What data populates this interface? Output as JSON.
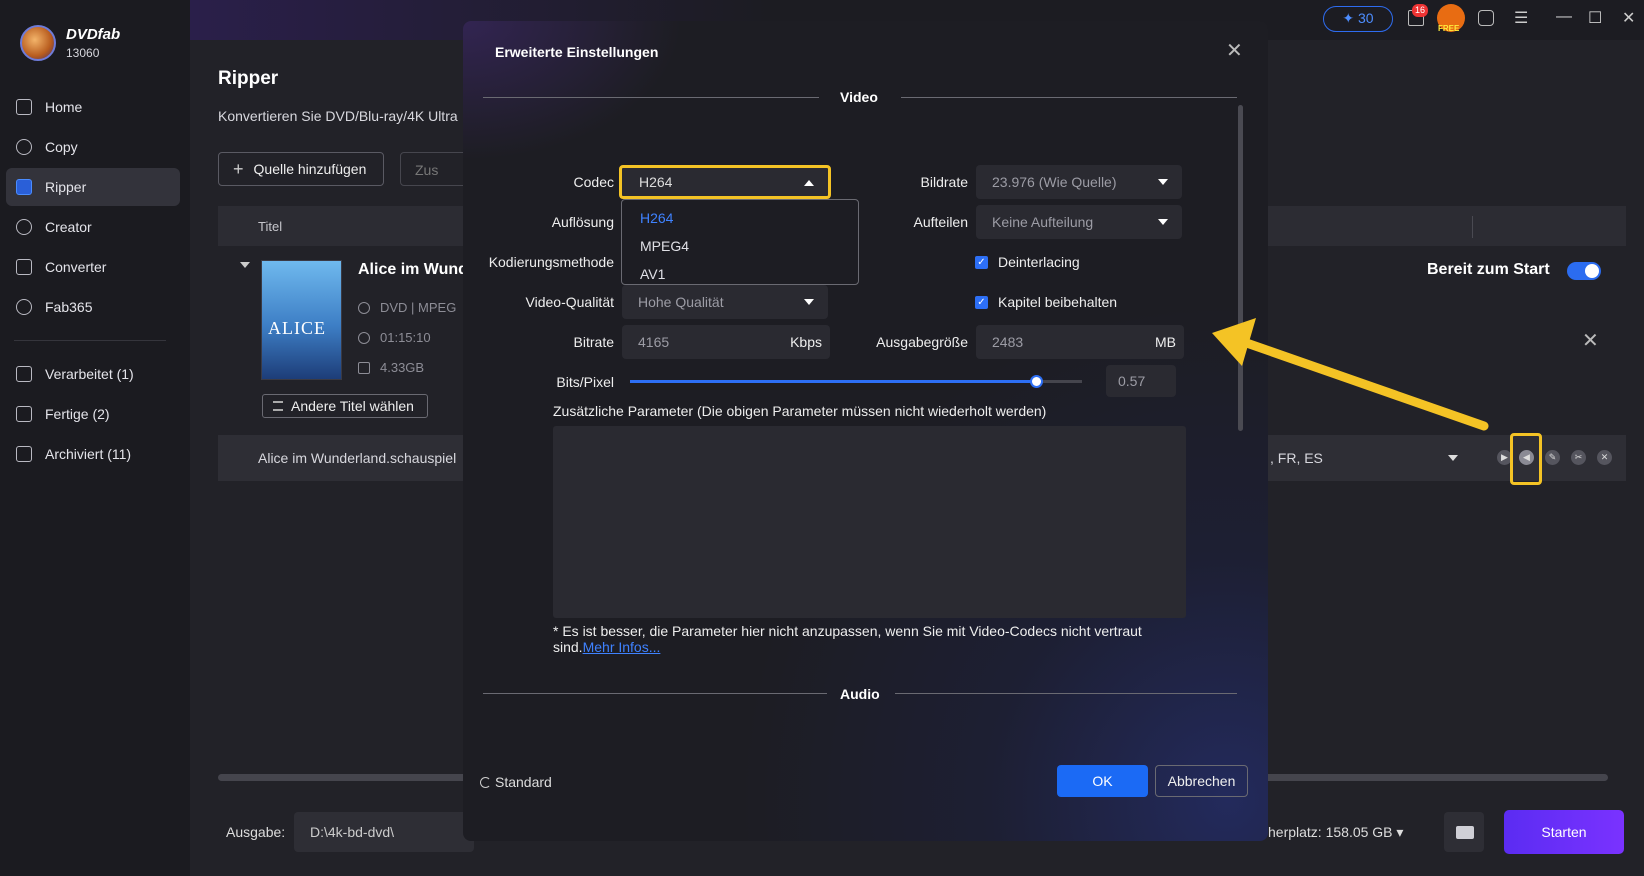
{
  "app": {
    "brand": "DVDfab",
    "version": "13060"
  },
  "sidebar": {
    "items": [
      {
        "label": "Home",
        "icon": "home-icon"
      },
      {
        "label": "Copy",
        "icon": "copy-icon"
      },
      {
        "label": "Ripper",
        "icon": "ripper-icon",
        "active": true
      },
      {
        "label": "Creator",
        "icon": "creator-icon"
      },
      {
        "label": "Converter",
        "icon": "converter-icon"
      },
      {
        "label": "Fab365",
        "icon": "fab365-icon"
      }
    ],
    "tasks": [
      {
        "label": "Verarbeitet (1)"
      },
      {
        "label": "Fertige (2)"
      },
      {
        "label": "Archiviert (11)"
      }
    ]
  },
  "titlebar": {
    "credits": "✦ 30",
    "notifications": "16",
    "gift_label": "FREE"
  },
  "page": {
    "title": "Ripper",
    "subtitle": "Konvertieren Sie DVD/Blu-ray/4K Ultra",
    "add_source": "Quelle hinzufügen",
    "merge": "Zus",
    "column_title": "Titel"
  },
  "item": {
    "title": "Alice im Wund",
    "cover_text": "ALICE",
    "format": "DVD | MPEG",
    "duration": "01:15:10",
    "size": "4.33GB",
    "other_titles": "Andere Titel wählen",
    "ready": "Bereit zum Start",
    "subrow_name": "Alice im Wunderland.schauspiel",
    "subrow_lang": ", FR, ES"
  },
  "footer": {
    "output_label": "Ausgabe:",
    "output_path": "D:\\4k-bd-dvd\\",
    "space": "herplatz: 158.05 GB ▾",
    "start": "Starten"
  },
  "modal": {
    "title": "Erweiterte Einstellungen",
    "video_section": "Video",
    "audio_section": "Audio",
    "codec_label": "Codec",
    "codec_value": "H264",
    "codec_options": [
      "H264",
      "MPEG4",
      "AV1"
    ],
    "resolution_label": "Auflösung",
    "encoding_label": "Kodierungsmethode",
    "quality_label": "Video-Qualität",
    "quality_value": "Hohe Qualität",
    "bitrate_label": "Bitrate",
    "bitrate_value": "4165",
    "bitrate_unit": "Kbps",
    "framerate_label": "Bildrate",
    "framerate_value": "23.976 (Wie Quelle)",
    "split_label": "Aufteilen",
    "split_value": "Keine Aufteilung",
    "deinterlacing": "Deinterlacing",
    "keep_chapters": "Kapitel beibehalten",
    "output_size_label": "Ausgabegröße",
    "output_size_value": "2483",
    "output_size_unit": "MB",
    "bpp_label": "Bits/Pixel",
    "bpp_value": "0.57",
    "bpp_fraction": 0.9,
    "extra_label": "Zusätzliche Parameter (Die obigen Parameter müssen nicht wiederholt werden)",
    "note": "* Es ist besser, die Parameter hier nicht anzupassen, wenn Sie mit Video-Codecs nicht vertraut sind.",
    "note_link": "Mehr Infos...",
    "standard": "Standard",
    "ok": "OK",
    "cancel": "Abbrechen"
  },
  "colors": {
    "accent": "#2d6ff5",
    "highlight": "#f4c325",
    "start": "#6a2ff8"
  }
}
